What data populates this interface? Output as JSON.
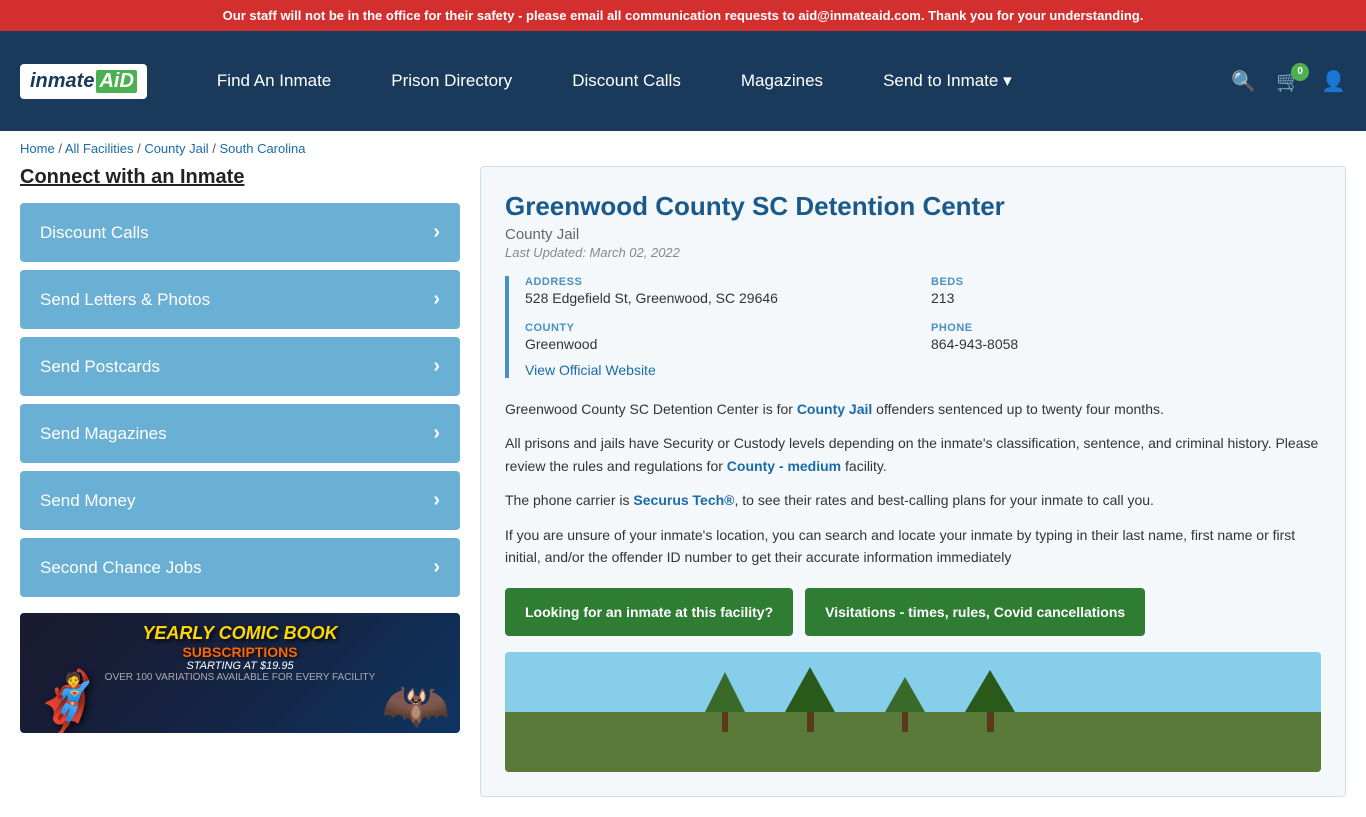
{
  "alert": {
    "text": "Our staff will not be in the office for their safety - please email all communication requests to aid@inmateaid.com. Thank you for your understanding."
  },
  "nav": {
    "logo_inmate": "inmate",
    "logo_aid": "AiD",
    "links": [
      {
        "id": "find-an-inmate",
        "label": "Find An Inmate"
      },
      {
        "id": "prison-directory",
        "label": "Prison Directory"
      },
      {
        "id": "discount-calls",
        "label": "Discount Calls"
      },
      {
        "id": "magazines",
        "label": "Magazines"
      },
      {
        "id": "send-to-inmate",
        "label": "Send to Inmate ▾"
      }
    ],
    "cart_count": "0"
  },
  "breadcrumb": {
    "home": "Home",
    "all_facilities": "All Facilities",
    "county_jail": "County Jail",
    "state": "South Carolina"
  },
  "sidebar": {
    "title": "Connect with an Inmate",
    "buttons": [
      {
        "id": "discount-calls-btn",
        "label": "Discount Calls"
      },
      {
        "id": "send-letters-btn",
        "label": "Send Letters & Photos"
      },
      {
        "id": "send-postcards-btn",
        "label": "Send Postcards"
      },
      {
        "id": "send-magazines-btn",
        "label": "Send Magazines"
      },
      {
        "id": "send-money-btn",
        "label": "Send Money"
      },
      {
        "id": "second-chance-btn",
        "label": "Second Chance Jobs"
      }
    ],
    "ad": {
      "title": "YEARLY COMIC BOOK",
      "subtitle": "SUBSCRIPTIONS",
      "price": "STARTING AT $19.95",
      "variations": "OVER 100 VARIATIONS AVAILABLE FOR EVERY FACILITY"
    }
  },
  "facility": {
    "name": "Greenwood County SC Detention Center",
    "type": "County Jail",
    "last_updated": "Last Updated: March 02, 2022",
    "address_label": "ADDRESS",
    "address_value": "528 Edgefield St, Greenwood, SC 29646",
    "beds_label": "BEDS",
    "beds_value": "213",
    "county_label": "COUNTY",
    "county_value": "Greenwood",
    "phone_label": "PHONE",
    "phone_value": "864-943-8058",
    "website_label": "View Official Website",
    "desc1": "Greenwood County SC Detention Center is for ",
    "desc1_link": "County Jail",
    "desc1_rest": " offenders sentenced up to twenty four months.",
    "desc2": "All prisons and jails have Security or Custody levels depending on the inmate's classification, sentence, and criminal history. Please review the rules and regulations for ",
    "desc2_link": "County - medium",
    "desc2_rest": " facility.",
    "desc3": "The phone carrier is ",
    "desc3_link": "Securus Tech®",
    "desc3_rest": ", to see their rates and best-calling plans for your inmate to call you.",
    "desc4": "If you are unsure of your inmate's location, you can search and locate your inmate by typing in their last name, first name or first initial, and/or the offender ID number to get their accurate information immediately",
    "btn1": "Looking for an inmate at this facility?",
    "btn2": "Visitations - times, rules, Covid cancellations"
  }
}
